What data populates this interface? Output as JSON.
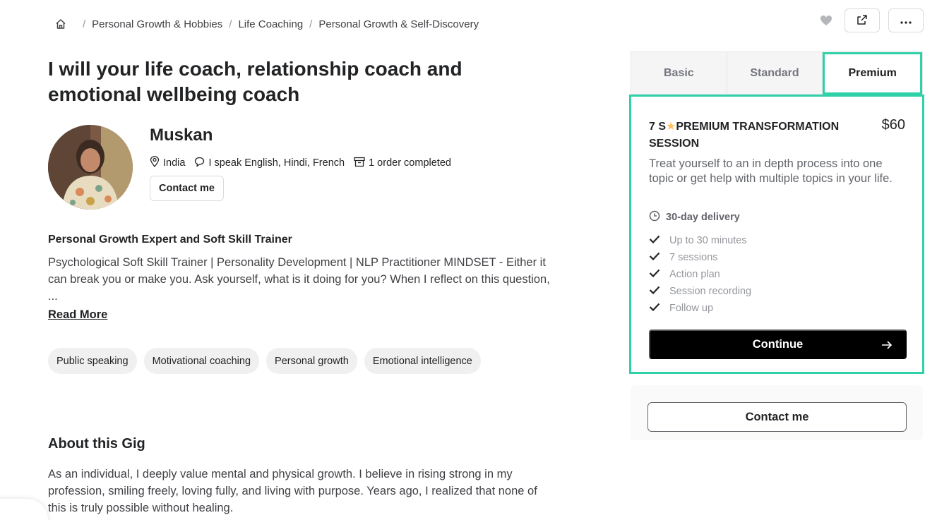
{
  "breadcrumb": {
    "items": [
      "Personal Growth & Hobbies",
      "Life Coaching",
      "Personal Growth & Self-Discovery"
    ]
  },
  "gig": {
    "title": "I will your life coach, relationship coach and emotional wellbeing coach"
  },
  "seller": {
    "name": "Muskan",
    "country": "India",
    "languages": "I speak English, Hindi, French",
    "orders": "1 order completed",
    "contact_label": "Contact me"
  },
  "profile": {
    "heading": "Personal Growth Expert and Soft Skill Trainer",
    "description": "Psychological Soft Skill Trainer | Personality Development | NLP Practitioner MINDSET - Either it can break you or make you. Ask yourself, what is it doing for you? When I reflect on this question, ...",
    "read_more": "Read More",
    "tags": [
      "Public speaking",
      "Motivational coaching",
      "Personal growth",
      "Emotional intelligence"
    ]
  },
  "about": {
    "heading": "About this Gig",
    "text": "As an individual, I deeply value mental and physical growth. I believe in rising strong in my profession, smiling freely, loving fully, and living with purpose. Years ago, I realized that none of this is truly possible without healing."
  },
  "packages": {
    "tabs": [
      "Basic",
      "Standard",
      "Premium"
    ],
    "active_tab": "Premium",
    "title_prefix": "7 S",
    "title_suffix": "PREMIUM TRANSFORMATION SESSION",
    "price": "$60",
    "description": "Treat yourself to an in depth process into one topic or get help with multiple topics in your life.",
    "delivery": "30-day delivery",
    "features": [
      "Up to 30 minutes",
      "7 sessions",
      "Action plan",
      "Session recording",
      "Follow up"
    ],
    "continue_label": "Continue",
    "contact_label": "Contact me"
  },
  "colors": {
    "accent_highlight": "#2fd2a8",
    "primary_button": "#000000",
    "star": "#ffbe5b"
  }
}
